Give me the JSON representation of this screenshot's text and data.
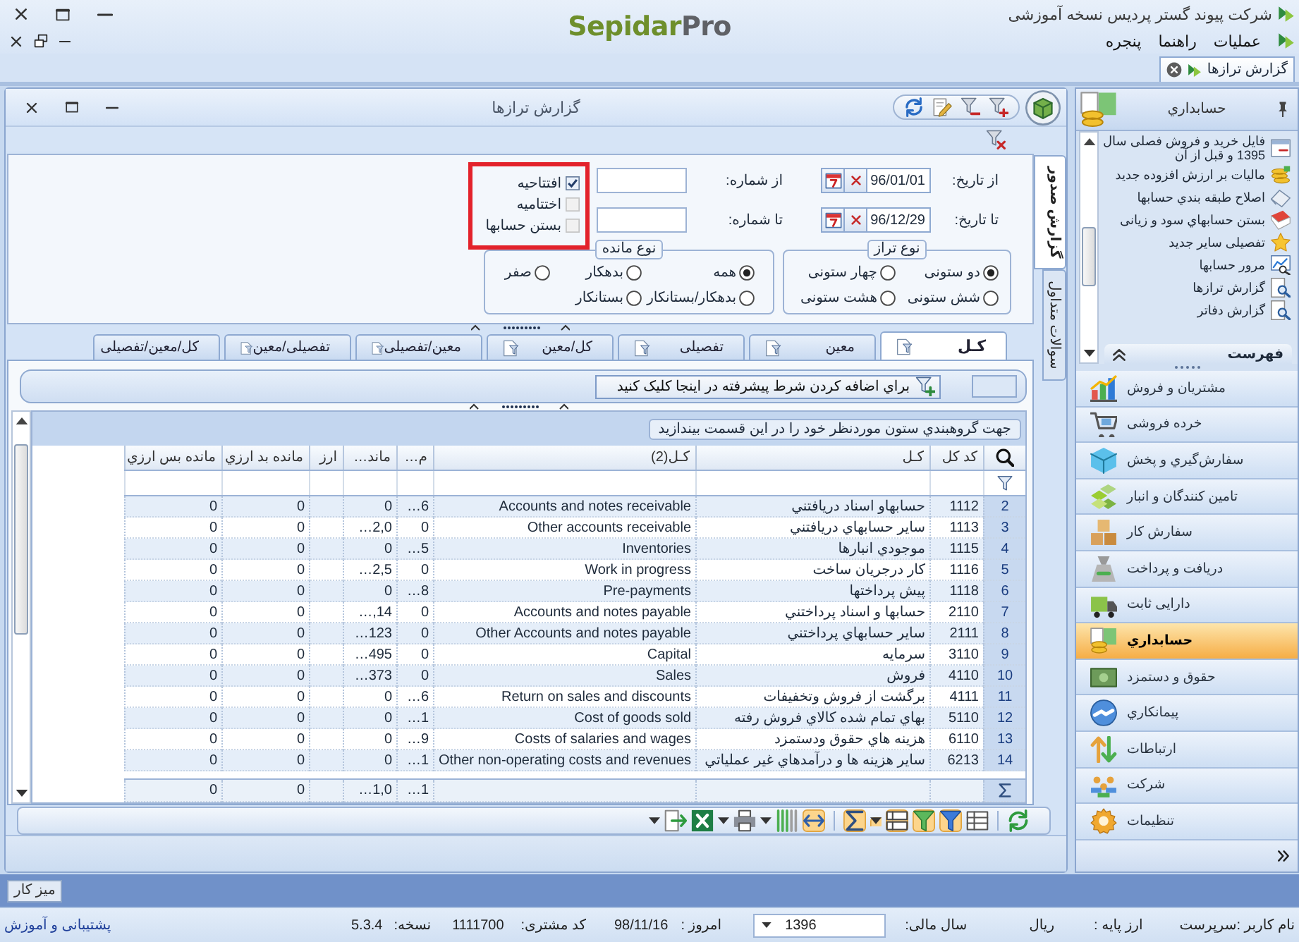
{
  "app": {
    "company": "شرکت پیوند گستر پردیس نسخه آموزشی",
    "logo": {
      "name": "Sepidar",
      "suffix": "Pro"
    }
  },
  "menu": [
    "عملیات",
    "راهنما",
    "پنجره"
  ],
  "document_tabs": [
    {
      "label": "گزارش ترازها",
      "selected": true
    }
  ],
  "report_window": {
    "title": "گزارش ترازها"
  },
  "side_tabs": [
    {
      "label": "گزارش صدور",
      "selected": true
    },
    {
      "label": "سوالات متداول",
      "selected": false
    }
  ],
  "date_filters": [
    {
      "label": "از تاریخ:",
      "value": "96/01/01"
    },
    {
      "label": "تا تاریخ:",
      "value": "96/12/29"
    }
  ],
  "number_filters": [
    {
      "label": "از شماره:"
    },
    {
      "label": "تا شماره:"
    }
  ],
  "options": {
    "highlighted": true,
    "items": [
      {
        "label": "افتتاحیه",
        "checked": true
      },
      {
        "label": "اختتامیه",
        "checked": false
      },
      {
        "label": "بستن حسابها",
        "checked": false
      }
    ]
  },
  "balance_type": {
    "title": "نوع تراز",
    "options": [
      {
        "label": "دو ستونی",
        "selected": true
      },
      {
        "label": "چهار ستونی",
        "selected": false
      },
      {
        "label": "شش ستونی",
        "selected": false
      },
      {
        "label": "هشت ستونی",
        "selected": false
      }
    ]
  },
  "remainder_type": {
    "title": "نوع مانده",
    "options": [
      {
        "label": "همه",
        "selected": true
      },
      {
        "label": "بدهکار",
        "selected": false
      },
      {
        "label": "صفر",
        "selected": false
      },
      {
        "label": "بدهکار/بستانکار",
        "selected": false
      },
      {
        "label": "بستانکار",
        "selected": false
      }
    ]
  },
  "report_tabs": [
    {
      "label": "کـل",
      "selected": true
    },
    {
      "label": "معین",
      "selected": false
    },
    {
      "label": "تفصیلی",
      "selected": false
    },
    {
      "label": "کل/معین",
      "selected": false
    },
    {
      "label": "معین/تفصیلی",
      "selected": false
    },
    {
      "label": "تفصیلی/معین",
      "selected": false
    },
    {
      "label": "کل/معین/تفصیلی",
      "selected": false
    }
  ],
  "condition_bar": {
    "button": "براي اضافه کردن شرط پیشرفته در اینجا کلیک کنید"
  },
  "grid": {
    "group_hint": "جهت گروهبندي ستون موردنظر خود را در این قسمت بیندازید",
    "columns": [
      "کد کل",
      "کـل",
      "کـل(2)",
      "م…",
      "ماند…",
      "ارز",
      "مانده بد ارزي",
      "مانده بس ارزي"
    ],
    "rows": [
      {
        "number": "2",
        "code": "1112",
        "account": "حسابهاو اسناد دریافتني",
        "account_2": "Accounts and notes receivable",
        "column_4": "…6",
        "column_5": "0",
        "fx_debit_balance": "0",
        "fx_credit_balance": "0"
      },
      {
        "number": "3",
        "code": "1113",
        "account": "سایر حسابهاي دریافتني",
        "account_2": "Other accounts receivable",
        "column_4": "0",
        "column_5": "…2,0",
        "fx_debit_balance": "0",
        "fx_credit_balance": "0"
      },
      {
        "number": "4",
        "code": "1115",
        "account": "موجودي انبارها",
        "account_2": "Inventories",
        "column_4": "…5",
        "column_5": "0",
        "fx_debit_balance": "0",
        "fx_credit_balance": "0"
      },
      {
        "number": "5",
        "code": "1116",
        "account": "کار درجریان ساخت",
        "account_2": "Work in progress",
        "column_4": "0",
        "column_5": "…2,5",
        "fx_debit_balance": "0",
        "fx_credit_balance": "0"
      },
      {
        "number": "6",
        "code": "1118",
        "account": "پیش پرداختها",
        "account_2": "Pre-payments",
        "column_4": "…8",
        "column_5": "0",
        "fx_debit_balance": "0",
        "fx_credit_balance": "0"
      },
      {
        "number": "7",
        "code": "2110",
        "account": "حسابها و اسناد پرداختني",
        "account_2": "Accounts and notes payable",
        "column_4": "0",
        "column_5": "…,14",
        "fx_debit_balance": "0",
        "fx_credit_balance": "0"
      },
      {
        "number": "8",
        "code": "2111",
        "account": "سایر حسابهاي پرداختني",
        "account_2": "Other Accounts and notes payable",
        "column_4": "0",
        "column_5": "…123",
        "fx_debit_balance": "0",
        "fx_credit_balance": "0"
      },
      {
        "number": "9",
        "code": "3110",
        "account": "سرمایه",
        "account_2": "Capital",
        "column_4": "0",
        "column_5": "…495",
        "fx_debit_balance": "0",
        "fx_credit_balance": "0"
      },
      {
        "number": "10",
        "code": "4110",
        "account": "فروش",
        "account_2": "Sales",
        "column_4": "0",
        "column_5": "…373",
        "fx_debit_balance": "0",
        "fx_credit_balance": "0"
      },
      {
        "number": "11",
        "code": "4111",
        "account": "برگشت از فروش وتخفیفات",
        "account_2": "Return on sales and discounts",
        "column_4": "…6",
        "column_5": "0",
        "fx_debit_balance": "0",
        "fx_credit_balance": "0"
      },
      {
        "number": "12",
        "code": "5110",
        "account": "بهاي تمام شده کالاي فروش رفته",
        "account_2": "Cost of goods sold",
        "column_4": "…1",
        "column_5": "0",
        "fx_debit_balance": "0",
        "fx_credit_balance": "0"
      },
      {
        "number": "13",
        "code": "6110",
        "account": "هزینه هاي حقوق ودستمزد",
        "account_2": "Costs of salaries and wages",
        "column_4": "…9",
        "column_5": "0",
        "fx_debit_balance": "0",
        "fx_credit_balance": "0"
      },
      {
        "number": "14",
        "code": "6213",
        "account": "سایر هزینه ها و درآمدهاي غیر عملیاتي",
        "account_2": "Other non-operating costs and revenues",
        "column_4": "…1",
        "column_5": "0",
        "fx_debit_balance": "0",
        "fx_credit_balance": "0"
      }
    ],
    "totals": {
      "column_4": "…1",
      "column_5": "…1,0",
      "fx_debit_balance": "0",
      "fx_credit_balance": "0"
    }
  },
  "grid_toolbar": [
    {
      "kind": "refresh",
      "on": false
    },
    {
      "kind": "separator"
    },
    {
      "kind": "columns",
      "on": false
    },
    {
      "kind": "filter",
      "on": true
    },
    {
      "kind": "autofilter",
      "on": true
    },
    {
      "kind": "grouping",
      "on": true
    },
    {
      "kind": "dropdown",
      "on": true
    },
    {
      "kind": "sum",
      "on": true
    },
    {
      "kind": "separator"
    },
    {
      "kind": "fit",
      "on": true
    },
    {
      "kind": "bands",
      "on": false
    },
    {
      "kind": "dropdown",
      "on": false
    },
    {
      "kind": "print",
      "on": false
    },
    {
      "kind": "dropdown",
      "on": false
    },
    {
      "kind": "excel",
      "on": false
    },
    {
      "kind": "export",
      "on": false
    },
    {
      "kind": "dropdown",
      "on": false
    }
  ],
  "sidebar": {
    "title": "حسابداري",
    "tasks": [
      "فایل خرید و فروش فصلی سال 1395 و قبل از آن",
      "مالیات بر ارزش افزوده جدید",
      "اصلاح طبقه بندي حسابها",
      "بستن حسابهاي سود و زیانی",
      "تفصیلی سایر جدید",
      "مرور حسابها",
      "گزارش ترازها",
      "گزارش دفاتر"
    ],
    "tasks_footer": "فهرست",
    "modules": [
      {
        "label": "مشتریان و فروش",
        "selected": false
      },
      {
        "label": "خرده فروشی",
        "selected": false
      },
      {
        "label": "سفارش‌گیري و پخش",
        "selected": false
      },
      {
        "label": "تامین کنندگان و انبار",
        "selected": false
      },
      {
        "label": "سفارش کار",
        "selected": false
      },
      {
        "label": "دریافت و پرداخت",
        "selected": false
      },
      {
        "label": "دارایی ثابت",
        "selected": false
      },
      {
        "label": "حسابداري",
        "selected": true
      },
      {
        "label": "حقوق و دستمزد",
        "selected": false
      },
      {
        "label": "پیمانکاري",
        "selected": false
      },
      {
        "label": "ارتباطات",
        "selected": false
      },
      {
        "label": "شرکت",
        "selected": false
      },
      {
        "label": "تنظیمات",
        "selected": false
      }
    ]
  },
  "taskbar": {
    "button": "میز کار"
  },
  "status_bar": {
    "user": "نام کاربر :سرپرست",
    "base_currency_label": "ارز پایه :",
    "base_currency": "ریال",
    "fiscal_year_label": "سال مالی:",
    "fiscal_year": "1396",
    "today_label": "امروز :",
    "today": "98/11/16",
    "customer_code_label": "کد مشتری:",
    "customer_code": "1111700",
    "version_label": "نسخه:",
    "version": "5.3.4",
    "support_link": "پشتیبانی و آموزش"
  }
}
